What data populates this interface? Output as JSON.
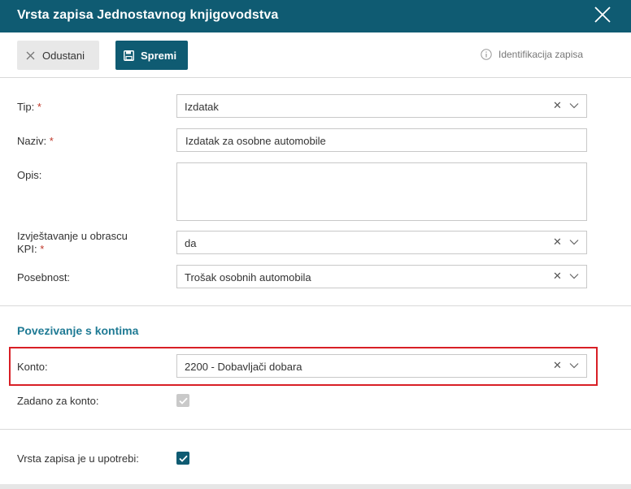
{
  "dialog": {
    "title": "Vrsta zapisa Jednostavnog knjigovodstva"
  },
  "toolbar": {
    "cancel_label": "Odustani",
    "save_label": "Spremi",
    "identification_label": "Identifikacija zapisa"
  },
  "form": {
    "tip": {
      "label": "Tip:",
      "required_mark": "*",
      "value": "Izdatak"
    },
    "naziv": {
      "label": "Naziv:",
      "required_mark": "*",
      "value": "Izdatak za osobne automobile"
    },
    "opis": {
      "label": "Opis:",
      "value": ""
    },
    "kpi": {
      "label_line1": "Izvještavanje u obrascu",
      "label_line2": "KPI:",
      "required_mark": "*",
      "value": "da"
    },
    "posebnost": {
      "label": "Posebnost:",
      "value": "Trošak osobnih automobila"
    }
  },
  "kontiranje": {
    "section_title": "Povezivanje s kontima",
    "konto": {
      "label": "Konto:",
      "value": "2200 - Dobavljači dobara"
    },
    "zadano": {
      "label": "Zadano za konto:",
      "checked": true,
      "disabled": true
    }
  },
  "usage": {
    "label": "Vrsta zapisa je u upotrebi:",
    "checked": true
  },
  "colors": {
    "header": "#0f5b72",
    "accent": "#1f7a94",
    "highlight": "#d81f26",
    "required": "#c0392b"
  },
  "icons": {
    "close": "close-icon",
    "cancel": "x-icon",
    "save": "floppy-disk-icon",
    "info": "info-icon",
    "clear": "clear-icon",
    "dropdown": "chevron-down-icon",
    "check": "checkmark-icon"
  }
}
